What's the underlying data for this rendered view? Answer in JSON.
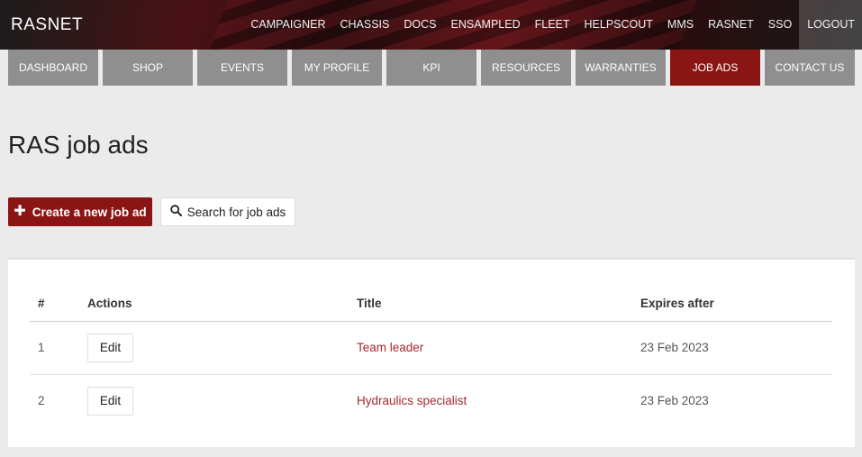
{
  "brand": "RASNET",
  "top_links": [
    "CAMPAIGNER",
    "CHASSIS",
    "DOCS",
    "ENSAMPLED",
    "FLEET",
    "HELPSCOUT",
    "MMS",
    "RASNET",
    "SSO",
    "LOGOUT"
  ],
  "main_nav": [
    "DASHBOARD",
    "SHOP",
    "EVENTS",
    "MY PROFILE",
    "KPI",
    "RESOURCES",
    "WARRANTIES",
    "JOB ADS",
    "CONTACT US"
  ],
  "active_nav": "JOB ADS",
  "page_title": "RAS job ads",
  "buttons": {
    "create": "Create a new job ad",
    "search": "Search for job ads"
  },
  "table": {
    "headers": [
      "#",
      "Actions",
      "Title",
      "Expires after"
    ],
    "rows": [
      {
        "num": "1",
        "action": "Edit",
        "title": "Team leader",
        "expires": "23 Feb 2023"
      },
      {
        "num": "2",
        "action": "Edit",
        "title": "Hydraulics specialist",
        "expires": "23 Feb 2023"
      }
    ]
  },
  "colors": {
    "accent": "#8b1414",
    "nav_inactive": "#8f8f8f",
    "link": "#a8282c"
  },
  "icons": {
    "create": "plus-icon",
    "search": "search-icon"
  }
}
